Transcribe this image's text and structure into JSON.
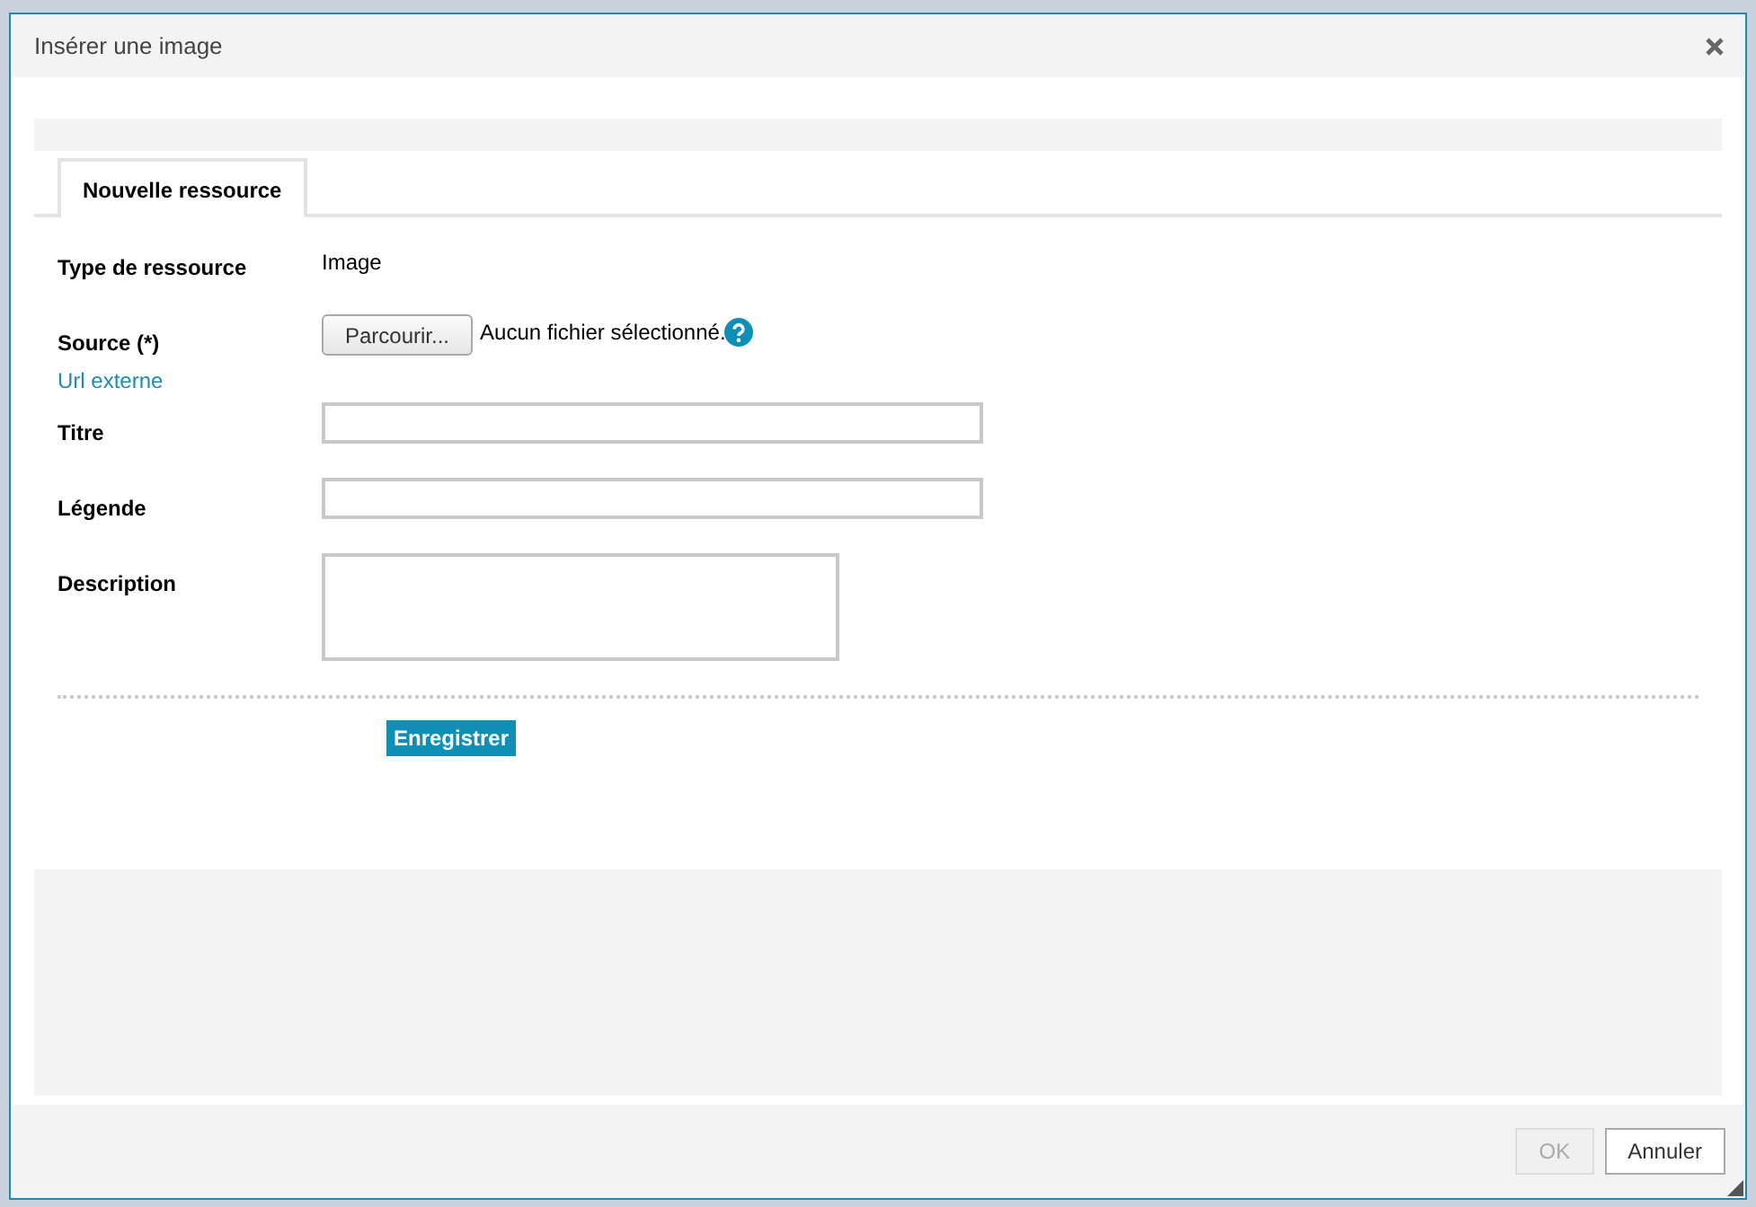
{
  "dialog": {
    "title": "Insérer une image"
  },
  "tabs": [
    {
      "label": "Nouvelle ressource",
      "selected": true
    }
  ],
  "form": {
    "fields": [
      {
        "kind": "text",
        "label": "Type de ressource",
        "value": "Image"
      },
      {
        "kind": "file",
        "label": "Source (*)",
        "link": "Url externe",
        "button": "Parcourir...",
        "status": "Aucun fichier sélectionné."
      },
      {
        "kind": "input",
        "label": "Titre"
      },
      {
        "kind": "input",
        "label": "Légende"
      },
      {
        "kind": "textarea",
        "label": "Description"
      }
    ],
    "submit": "Enregistrer"
  },
  "buttons": [
    {
      "label": "OK",
      "disabled": true
    },
    {
      "label": "Annuler",
      "disabled": false
    }
  ]
}
